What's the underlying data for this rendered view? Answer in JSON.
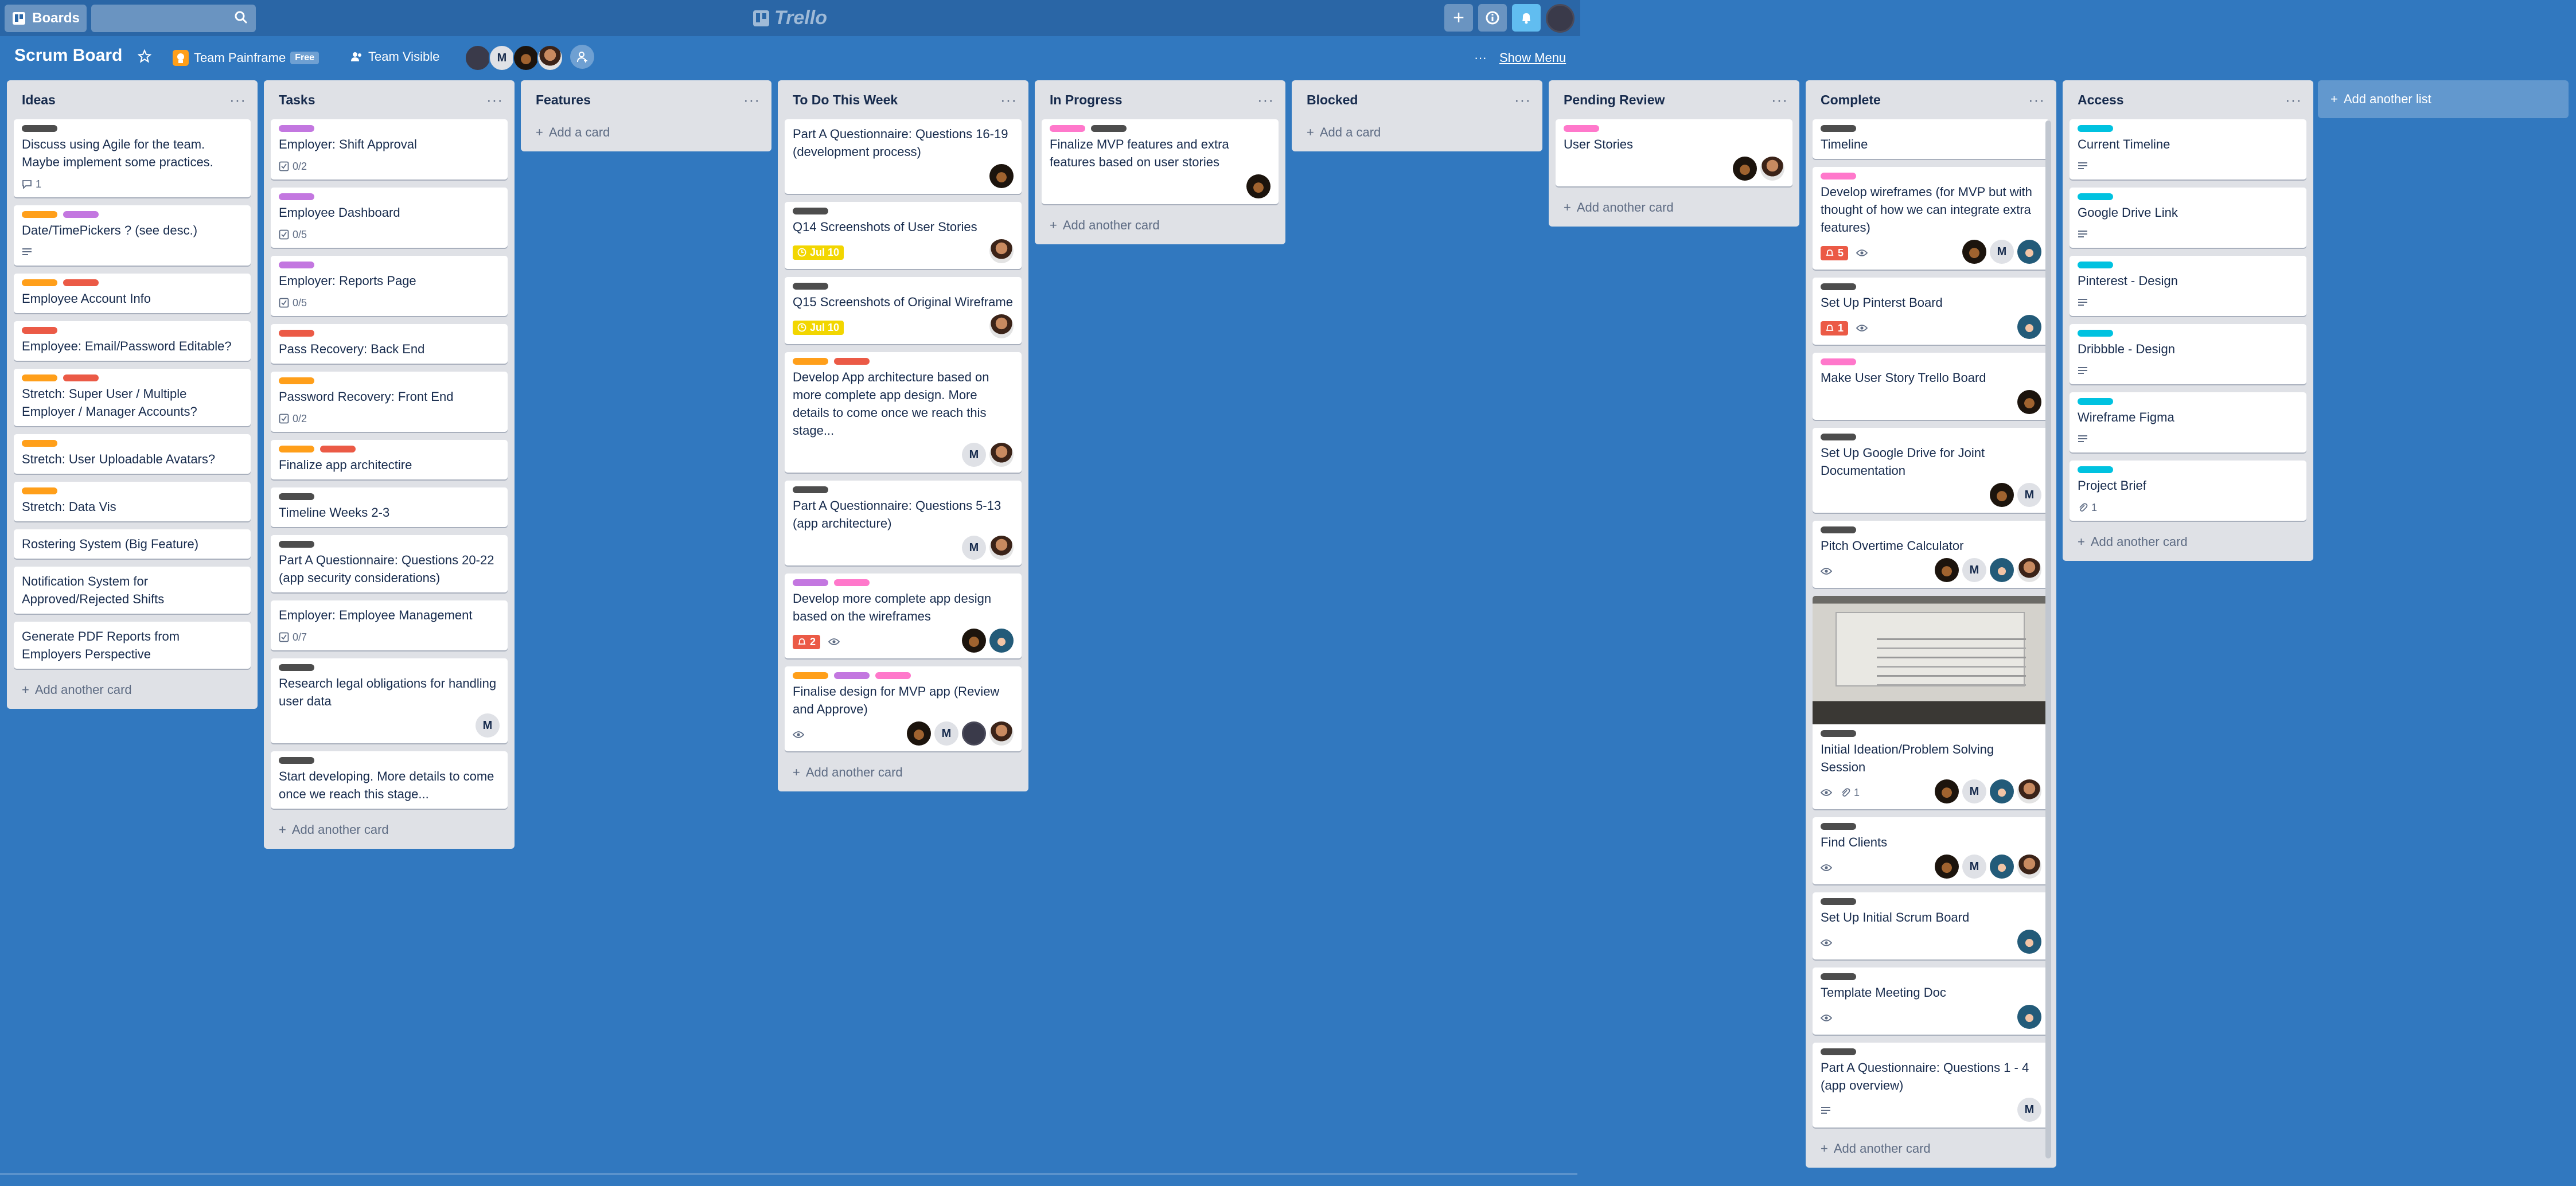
{
  "topbar": {
    "boards_label": "Boards",
    "logo_text": "Trello"
  },
  "board": {
    "title": "Scrum Board",
    "team": "Team Painframe",
    "plan": "Free",
    "visibility": "Team Visible",
    "show_menu": "Show Menu"
  },
  "colors": {
    "green": "#61bd4f",
    "orange": "#ff9f1a",
    "red": "#eb5a46",
    "purple": "#c377e0",
    "pink": "#ff78cb",
    "sky": "#00c2e0",
    "black": "#4d4d4d"
  },
  "add_card": "Add a card",
  "add_another_card": "Add another card",
  "add_another_list": "Add another list",
  "lists": [
    {
      "title": "Ideas",
      "cards": [
        {
          "labels": [
            "black"
          ],
          "title": "Discuss using Agile for the team. Maybe implement some practices.",
          "comments": "1"
        },
        {
          "labels": [
            "orange",
            "purple"
          ],
          "title": "Date/TimePickers ? (see desc.)",
          "desc": true
        },
        {
          "labels": [
            "orange",
            "red"
          ],
          "title": "Employee Account Info"
        },
        {
          "labels": [
            "red"
          ],
          "title": "Employee: Email/Password Editable?"
        },
        {
          "labels": [
            "orange",
            "red"
          ],
          "title": "Stretch: Super User / Multiple Employer / Manager Accounts?"
        },
        {
          "labels": [
            "orange"
          ],
          "title": "Stretch: User Uploadable Avatars?"
        },
        {
          "labels": [
            "orange"
          ],
          "title": "Stretch: Data Vis"
        },
        {
          "labels": [],
          "title": "Rostering System (Big Feature)"
        },
        {
          "labels": [],
          "title": "Notification System for Approved/Rejected Shifts"
        },
        {
          "labels": [],
          "title": "Generate PDF Reports from Employers Perspective"
        }
      ]
    },
    {
      "title": "Tasks",
      "cards": [
        {
          "labels": [
            "purple"
          ],
          "title": "Employer: Shift Approval",
          "checklist": "0/2"
        },
        {
          "labels": [
            "purple"
          ],
          "title": "Employee Dashboard",
          "checklist": "0/5"
        },
        {
          "labels": [
            "purple"
          ],
          "title": "Employer: Reports Page",
          "checklist": "0/5"
        },
        {
          "labels": [
            "red"
          ],
          "title": "Pass Recovery: Back End"
        },
        {
          "labels": [
            "orange"
          ],
          "title": "Password Recovery: Front End",
          "checklist": "0/2"
        },
        {
          "labels": [
            "orange",
            "red"
          ],
          "title": "Finalize app architectire"
        },
        {
          "labels": [
            "black"
          ],
          "title": "Timeline Weeks 2-3"
        },
        {
          "labels": [
            "black"
          ],
          "title": "Part A Questionnaire: Questions 20-22 (app security considerations)"
        },
        {
          "labels": [],
          "title": "Employer: Employee Management",
          "checklist": "0/7"
        },
        {
          "labels": [
            "black"
          ],
          "title": "Research legal obligations for handling user data",
          "avatars": [
            "m"
          ]
        },
        {
          "labels": [
            "black"
          ],
          "title": "Start developing. More details to come once we reach this stage..."
        }
      ]
    },
    {
      "title": "Features",
      "cards": []
    },
    {
      "title": "To Do This Week",
      "cards": [
        {
          "labels": [],
          "title": "Part A Questionnaire: Questions 16-19 (development process)",
          "avatars": [
            "curly"
          ]
        },
        {
          "labels": [
            "black"
          ],
          "title": "Q14 Screenshots of User Stories",
          "due": "Jul 10",
          "avatars": [
            "face"
          ]
        },
        {
          "labels": [
            "black"
          ],
          "title": "Q15 Screenshots of Original Wireframe",
          "due": "Jul 10",
          "avatars": [
            "face"
          ]
        },
        {
          "labels": [
            "orange",
            "red"
          ],
          "title": "Develop App architecture based on more complete app design. More details to come once we reach this stage...",
          "avatars": [
            "m",
            "face"
          ]
        },
        {
          "labels": [
            "black"
          ],
          "title": "Part A Questionnaire: Questions 5-13 (app architecture)",
          "avatars": [
            "m",
            "face"
          ]
        },
        {
          "labels": [
            "purple",
            "pink"
          ],
          "title": "Develop more complete app design based on the wireframes",
          "alert": "2",
          "watch": true,
          "avatars": [
            "curly",
            "blue"
          ]
        },
        {
          "labels": [
            "orange",
            "purple",
            "pink"
          ],
          "title": "Finalise design for MVP app (Review and Approve)",
          "watch": true,
          "avatars": [
            "curly",
            "m",
            "dark",
            "face"
          ]
        }
      ]
    },
    {
      "title": "In Progress",
      "cards": [
        {
          "labels": [
            "pink",
            "black"
          ],
          "title": "Finalize MVP features and extra features based on user stories",
          "avatars": [
            "curly"
          ]
        }
      ]
    },
    {
      "title": "Blocked",
      "cards": []
    },
    {
      "title": "Pending Review",
      "cards": [
        {
          "labels": [
            "pink"
          ],
          "title": "User Stories",
          "avatars": [
            "curly",
            "face"
          ]
        }
      ]
    },
    {
      "title": "Complete",
      "cards": [
        {
          "labels": [
            "black"
          ],
          "title": "Timeline"
        },
        {
          "labels": [
            "pink"
          ],
          "title": "Develop wireframes (for MVP but with thought of how we can integrate extra features)",
          "alert": "5",
          "watch": true,
          "avatars": [
            "curly",
            "m",
            "blue"
          ]
        },
        {
          "labels": [
            "black"
          ],
          "title": "Set Up Pinterst Board",
          "alert": "1",
          "watch": true,
          "avatars": [
            "blue"
          ]
        },
        {
          "labels": [
            "pink"
          ],
          "title": "Make User Story Trello Board",
          "avatars": [
            "curly"
          ]
        },
        {
          "labels": [
            "black"
          ],
          "title": "Set Up Google Drive for Joint Documentation",
          "avatars": [
            "curly",
            "m"
          ]
        },
        {
          "labels": [
            "black"
          ],
          "title": "Pitch Overtime Calculator",
          "watch": true,
          "avatars": [
            "curly",
            "m",
            "blue",
            "face"
          ]
        },
        {
          "photo": true,
          "labels": [
            "black"
          ],
          "title": "Initial Ideation/Problem Solving Session",
          "watch": true,
          "attachments": "1",
          "avatars": [
            "curly",
            "m",
            "blue",
            "face"
          ]
        },
        {
          "labels": [
            "black"
          ],
          "title": "Find Clients",
          "watch": true,
          "avatars": [
            "curly",
            "m",
            "blue",
            "face"
          ]
        },
        {
          "labels": [
            "black"
          ],
          "title": "Set Up Initial Scrum Board",
          "watch": true,
          "avatars": [
            "blue"
          ]
        },
        {
          "labels": [
            "black"
          ],
          "title": "Template Meeting Doc",
          "watch": true,
          "avatars": [
            "blue"
          ]
        },
        {
          "labels": [
            "black"
          ],
          "title": "Part A Questionnaire: Questions 1 - 4 (app overview)",
          "desc": true,
          "avatars": [
            "m"
          ]
        }
      ]
    },
    {
      "title": "Access",
      "cards": [
        {
          "labels": [
            "sky"
          ],
          "title": "Current Timeline",
          "desc": true
        },
        {
          "labels": [
            "sky"
          ],
          "title": "Google Drive Link",
          "desc": true
        },
        {
          "labels": [
            "sky"
          ],
          "title": "Pinterest - Design",
          "desc": true
        },
        {
          "labels": [
            "sky"
          ],
          "title": "Dribbble - Design",
          "desc": true
        },
        {
          "labels": [
            "sky"
          ],
          "title": "Wireframe Figma",
          "desc": true
        },
        {
          "labels": [
            "sky"
          ],
          "title": "Project Brief",
          "attachments": "1"
        }
      ]
    }
  ]
}
